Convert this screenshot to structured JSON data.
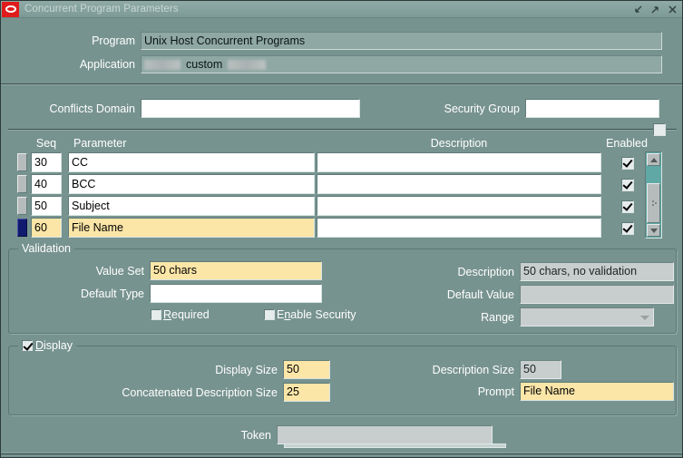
{
  "window": {
    "title": "Concurrent Program Parameters",
    "logo_icon": "oracle-logo-icon",
    "controls": [
      {
        "name": "minimize-button",
        "icon": "arrow-down-left-icon",
        "label": "Minimize"
      },
      {
        "name": "maximize-button",
        "icon": "arrow-up-right-icon",
        "label": "Maximize"
      },
      {
        "name": "close-button",
        "icon": "close-x-icon",
        "label": "Close"
      }
    ]
  },
  "header": {
    "program_label": "Program",
    "program_value": "Unix Host Concurrent Programs",
    "application_label": "Application",
    "application_value_visible": "custom",
    "application_redacted_before": true,
    "application_redacted_after": true
  },
  "filters": {
    "conflicts_domain_label": "Conflicts Domain",
    "conflicts_domain_value": "",
    "security_group_label": "Security Group",
    "security_group_value": "",
    "divider_checkbox_checked": false
  },
  "grid": {
    "columns": [
      "Seq",
      "Parameter",
      "Description",
      "Enabled"
    ],
    "rows": [
      {
        "seq": "30",
        "parameter": "CC",
        "description": "",
        "enabled": true,
        "current": false
      },
      {
        "seq": "40",
        "parameter": "BCC",
        "description": "",
        "enabled": true,
        "current": false
      },
      {
        "seq": "50",
        "parameter": "Subject",
        "description": "",
        "enabled": true,
        "current": false
      },
      {
        "seq": "60",
        "parameter": "File Name",
        "description": "",
        "enabled": true,
        "current": true
      }
    ],
    "scrollbar": {
      "up_icon": "scroll-up-arrow-icon",
      "down_icon": "scroll-down-arrow-icon",
      "thumb_icon": "scroll-thumb-grip-icon"
    }
  },
  "validation": {
    "title": "Validation",
    "value_set_label": "Value Set",
    "value_set_value": "50 chars",
    "default_type_label": "Default Type",
    "default_type_value": "",
    "required_label": "Required",
    "required_checked": false,
    "enable_security_label": "Enable Security",
    "enable_security_checked": false,
    "description_label": "Description",
    "description_value": "50 chars, no validation",
    "default_value_label": "Default Value",
    "default_value_value": "",
    "range_label": "Range",
    "range_value": "",
    "range_arrow_icon": "chevron-down-icon"
  },
  "display": {
    "title": "Display",
    "checked": true,
    "display_size_label": "Display Size",
    "display_size_value": "50",
    "concatenated_description_size_label": "Concatenated Description Size",
    "concatenated_description_size_value": "25",
    "description_size_label": "Description Size",
    "description_size_value": "50",
    "prompt_label": "Prompt",
    "prompt_value": "File Name"
  },
  "footer": {
    "token_label": "Token",
    "token_value": ""
  },
  "colors": {
    "window_bg": "#77938f",
    "titlebar_bg": "#86a29e",
    "field_white": "#ffffff",
    "field_highlight": "#fbe6a8",
    "field_disabled": "#c8cdcd",
    "accent_selected_row": "#101a6e",
    "logo_red": "#e01b1b"
  }
}
